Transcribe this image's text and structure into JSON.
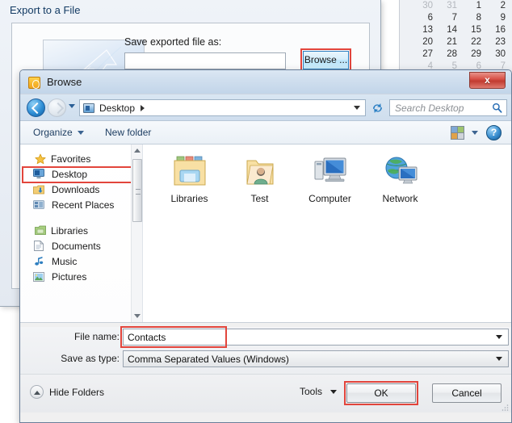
{
  "calendar": {
    "rows": [
      {
        "cells": [
          {
            "d": "30",
            "dim": true
          },
          {
            "d": "31",
            "dim": true
          },
          {
            "d": "1",
            "dim": false
          },
          {
            "d": "2",
            "dim": false
          }
        ]
      },
      {
        "cells": [
          {
            "d": "6",
            "dim": false
          },
          {
            "d": "7",
            "dim": false
          },
          {
            "d": "8",
            "dim": false
          },
          {
            "d": "9",
            "dim": false
          }
        ]
      },
      {
        "cells": [
          {
            "d": "13",
            "dim": false
          },
          {
            "d": "14",
            "dim": false
          },
          {
            "d": "15",
            "dim": false
          },
          {
            "d": "16",
            "dim": false
          }
        ]
      },
      {
        "cells": [
          {
            "d": "20",
            "dim": false
          },
          {
            "d": "21",
            "dim": false
          },
          {
            "d": "22",
            "dim": false
          },
          {
            "d": "23",
            "dim": false
          }
        ]
      },
      {
        "cells": [
          {
            "d": "27",
            "dim": false
          },
          {
            "d": "28",
            "dim": false
          },
          {
            "d": "29",
            "dim": false
          },
          {
            "d": "30",
            "dim": false
          }
        ]
      },
      {
        "cells": [
          {
            "d": "4",
            "dim": true
          },
          {
            "d": "5",
            "dim": true
          },
          {
            "d": "6",
            "dim": true
          },
          {
            "d": "7",
            "dim": true
          }
        ]
      }
    ]
  },
  "export_window": {
    "title": "Export to a File",
    "save_as_label": "Save exported file as:",
    "save_as_value": "",
    "save_as_placeholder": "",
    "browse_label": "Browse ..."
  },
  "browse_dialog": {
    "title": "Browse",
    "close_label": "x",
    "address": {
      "breadcrumb_label": "Desktop",
      "search_placeholder": "Search Desktop"
    },
    "toolbar": {
      "organize_label": "Organize",
      "new_folder_label": "New folder",
      "help_label": "?"
    },
    "nav_pane": {
      "groups": [
        {
          "header": "Favorites",
          "icon": "star-icon",
          "items": [
            {
              "label": "Desktop",
              "icon": "desktop-icon",
              "highlighted": true
            },
            {
              "label": "Downloads",
              "icon": "downloads-icon",
              "highlighted": false
            },
            {
              "label": "Recent Places",
              "icon": "recent-places-icon",
              "highlighted": false
            }
          ]
        },
        {
          "header": "Libraries",
          "icon": "libraries-icon",
          "items": [
            {
              "label": "Documents",
              "icon": "documents-icon",
              "highlighted": false
            },
            {
              "label": "Music",
              "icon": "music-icon",
              "highlighted": false
            },
            {
              "label": "Pictures",
              "icon": "pictures-icon",
              "highlighted": false
            }
          ]
        }
      ]
    },
    "files": [
      {
        "label": "Libraries",
        "icon": "libraries-folder-icon"
      },
      {
        "label": "Test",
        "icon": "user-folder-icon"
      },
      {
        "label": "Computer",
        "icon": "computer-icon"
      },
      {
        "label": "Network",
        "icon": "network-icon"
      }
    ],
    "form": {
      "filename_label": "File name:",
      "filename_value": "Contacts",
      "savetype_label": "Save as type:",
      "savetype_value": "Comma Separated Values (Windows)"
    },
    "footer": {
      "hide_folders_label": "Hide Folders",
      "tools_label": "Tools",
      "ok_label": "OK",
      "cancel_label": "Cancel"
    }
  },
  "colors": {
    "annotation_red": "#e2453c",
    "accent_blue": "#2f8fd6",
    "close_red": "#c13b30"
  }
}
